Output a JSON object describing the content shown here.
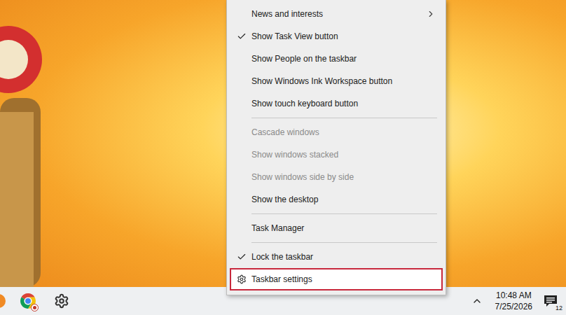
{
  "menu": {
    "items": [
      {
        "kind": "submenu",
        "label": "News and interests",
        "checked": false,
        "disabled": false,
        "outlined": false
      },
      {
        "kind": "item",
        "label": "Show Task View button",
        "checked": true,
        "disabled": false,
        "outlined": false
      },
      {
        "kind": "item",
        "label": "Show People on the taskbar",
        "checked": false,
        "disabled": false,
        "outlined": false
      },
      {
        "kind": "item",
        "label": "Show Windows Ink Workspace button",
        "checked": false,
        "disabled": false,
        "outlined": false
      },
      {
        "kind": "item",
        "label": "Show touch keyboard button",
        "checked": false,
        "disabled": false,
        "outlined": false
      },
      {
        "kind": "separator"
      },
      {
        "kind": "item",
        "label": "Cascade windows",
        "checked": false,
        "disabled": true,
        "outlined": false
      },
      {
        "kind": "item",
        "label": "Show windows stacked",
        "checked": false,
        "disabled": true,
        "outlined": false
      },
      {
        "kind": "item",
        "label": "Show windows side by side",
        "checked": false,
        "disabled": true,
        "outlined": false
      },
      {
        "kind": "item",
        "label": "Show the desktop",
        "checked": false,
        "disabled": false,
        "outlined": false
      },
      {
        "kind": "separator"
      },
      {
        "kind": "item",
        "label": "Task Manager",
        "checked": false,
        "disabled": false,
        "outlined": false
      },
      {
        "kind": "separator"
      },
      {
        "kind": "item",
        "label": "Lock the taskbar",
        "checked": true,
        "disabled": false,
        "outlined": false
      },
      {
        "kind": "settings",
        "label": "Taskbar settings",
        "checked": false,
        "disabled": false,
        "outlined": true
      }
    ]
  },
  "taskbar": {
    "apps": [
      {
        "kind": "partial"
      },
      {
        "kind": "chrome"
      },
      {
        "kind": "settings"
      }
    ],
    "tray": {
      "time": "10:48 AM",
      "date": "7/25/2026",
      "notification_count": "12"
    }
  }
}
